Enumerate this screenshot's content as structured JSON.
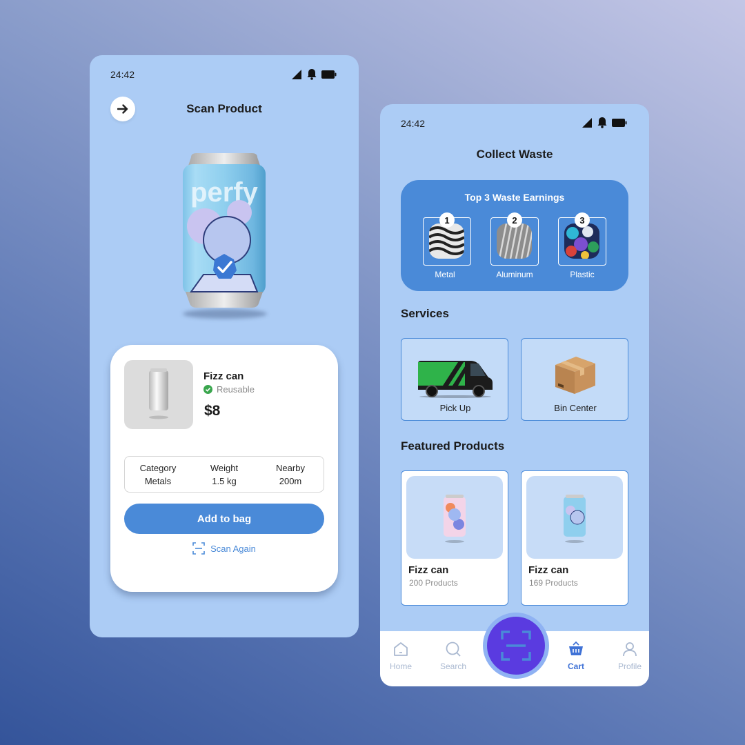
{
  "left_screen": {
    "status_time": "24:42",
    "title": "Scan Product",
    "product": {
      "name": "Fizz can",
      "status": "Reusable",
      "price": "$8",
      "can_brand": "perfy"
    },
    "specs": [
      {
        "label": "Category",
        "value": "Metals"
      },
      {
        "label": "Weight",
        "value": "1.5 kg"
      },
      {
        "label": "Nearby",
        "value": "200m"
      }
    ],
    "add_button": "Add to bag",
    "scan_again": "Scan Again"
  },
  "right_screen": {
    "status_time": "24:42",
    "title": "Collect Waste",
    "earnings": {
      "title": "Top 3 Waste Earnings",
      "items": [
        {
          "rank": "1",
          "label": "Metal"
        },
        {
          "rank": "2",
          "label": "Aluminum"
        },
        {
          "rank": "3",
          "label": "Plastic"
        }
      ]
    },
    "services_title": "Services",
    "services": [
      {
        "label": "Pick Up",
        "icon": "van-icon"
      },
      {
        "label": "Bin Center",
        "icon": "box-icon"
      }
    ],
    "featured_title": "Featured Products",
    "featured": [
      {
        "name": "Fizz can",
        "count": "200 Products"
      },
      {
        "name": "Fizz can",
        "count": "169 Products"
      }
    ],
    "nav": [
      {
        "label": "Home",
        "icon": "home-icon"
      },
      {
        "label": "Search",
        "icon": "search-icon"
      },
      {
        "label": "Cart",
        "icon": "cart-icon"
      },
      {
        "label": "Profile",
        "icon": "profile-icon"
      }
    ],
    "active_nav": "Cart"
  },
  "colors": {
    "accent": "#4a8ad8",
    "phone_bg": "#acccf5",
    "fab": "#5a3be0",
    "active_nav": "#3f72d6",
    "success": "#3aa64e"
  }
}
